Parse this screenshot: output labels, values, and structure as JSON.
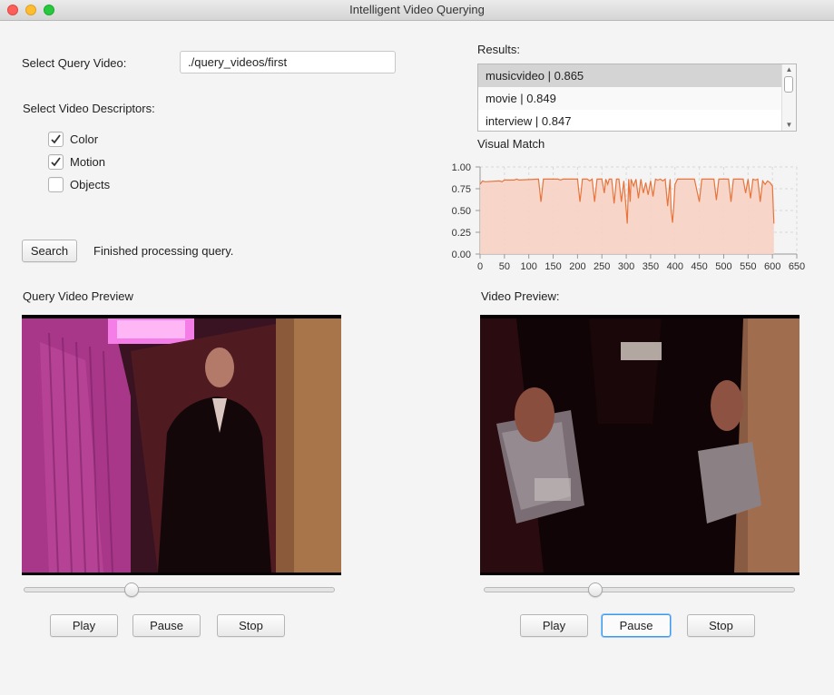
{
  "window": {
    "title": "Intelligent Video Querying"
  },
  "query": {
    "label": "Select Query Video:",
    "value": "./query_videos/first"
  },
  "descriptors": {
    "label": "Select Video Descriptors:",
    "items": [
      {
        "label": "Color",
        "checked": true
      },
      {
        "label": "Motion",
        "checked": true
      },
      {
        "label": "Objects",
        "checked": false
      }
    ]
  },
  "search": {
    "button_label": "Search",
    "status": "Finished processing query."
  },
  "results": {
    "label": "Results:",
    "items": [
      {
        "label": "musicvideo | 0.865",
        "selected": true
      },
      {
        "label": "movie | 0.849",
        "selected": false
      },
      {
        "label": "interview | 0.847",
        "selected": false
      }
    ]
  },
  "visual_match": {
    "label": "Visual Match"
  },
  "query_preview": {
    "label": "Query Video Preview",
    "slider_value": 0.35,
    "play_label": "Play",
    "pause_label": "Pause",
    "stop_label": "Stop"
  },
  "video_preview": {
    "label": "Video Preview:",
    "slider_value": 0.36,
    "play_label": "Play",
    "pause_label": "Pause",
    "stop_label": "Stop"
  },
  "colors": {
    "series_line": "#e8743b",
    "series_fill": "#f7d3c4",
    "focus": "#3b99f0"
  },
  "chart_data": {
    "type": "area",
    "title": "",
    "xlabel": "",
    "ylabel": "",
    "xlim": [
      0,
      650
    ],
    "ylim": [
      0,
      1.0
    ],
    "xticks": [
      0,
      50,
      100,
      150,
      200,
      250,
      300,
      350,
      400,
      450,
      500,
      550,
      600,
      650
    ],
    "yticks": [
      0.0,
      0.25,
      0.5,
      0.75,
      1.0
    ],
    "xtick_labels": [
      "0",
      "50",
      "100",
      "150",
      "200",
      "250",
      "300",
      "350",
      "400",
      "450",
      "500",
      "550",
      "600",
      "650"
    ],
    "ytick_labels": [
      "0.00",
      "0.25",
      "0.50",
      "0.75",
      "1.00"
    ],
    "grid": true,
    "legend": false,
    "series": [
      {
        "x": [
          0,
          5,
          10,
          40,
          45,
          50,
          70,
          75,
          80,
          120,
          125,
          130,
          160,
          165,
          170,
          200,
          205,
          210,
          220,
          225,
          230,
          235,
          240,
          250,
          255,
          258,
          262,
          265,
          270,
          275,
          280,
          285,
          290,
          295,
          300,
          302,
          305,
          308,
          310,
          315,
          320,
          325,
          330,
          335,
          340,
          345,
          350,
          355,
          360,
          365,
          370,
          375,
          380,
          385,
          390,
          392,
          395,
          398,
          400,
          405,
          410,
          420,
          440,
          450,
          455,
          460,
          480,
          485,
          490,
          500,
          510,
          515,
          520,
          530,
          540,
          545,
          550,
          555,
          560,
          565,
          570,
          575,
          580,
          585,
          590,
          595,
          600,
          602,
          603
        ],
        "y": [
          0.8,
          0.84,
          0.83,
          0.84,
          0.83,
          0.85,
          0.85,
          0.86,
          0.85,
          0.86,
          0.6,
          0.86,
          0.86,
          0.85,
          0.86,
          0.86,
          0.6,
          0.86,
          0.86,
          0.84,
          0.86,
          0.6,
          0.86,
          0.86,
          0.7,
          0.86,
          0.8,
          0.86,
          0.86,
          0.58,
          0.86,
          0.86,
          0.6,
          0.84,
          0.5,
          0.35,
          0.86,
          0.6,
          0.86,
          0.78,
          0.86,
          0.64,
          0.86,
          0.7,
          0.82,
          0.68,
          0.84,
          0.66,
          0.86,
          0.85,
          0.86,
          0.84,
          0.86,
          0.55,
          0.86,
          0.5,
          0.36,
          0.6,
          0.8,
          0.86,
          0.86,
          0.86,
          0.86,
          0.6,
          0.86,
          0.86,
          0.86,
          0.62,
          0.86,
          0.86,
          0.86,
          0.6,
          0.86,
          0.86,
          0.86,
          0.7,
          0.86,
          0.64,
          0.86,
          0.85,
          0.86,
          0.6,
          0.84,
          0.8,
          0.84,
          0.82,
          0.78,
          0.5,
          0.35
        ]
      }
    ]
  }
}
